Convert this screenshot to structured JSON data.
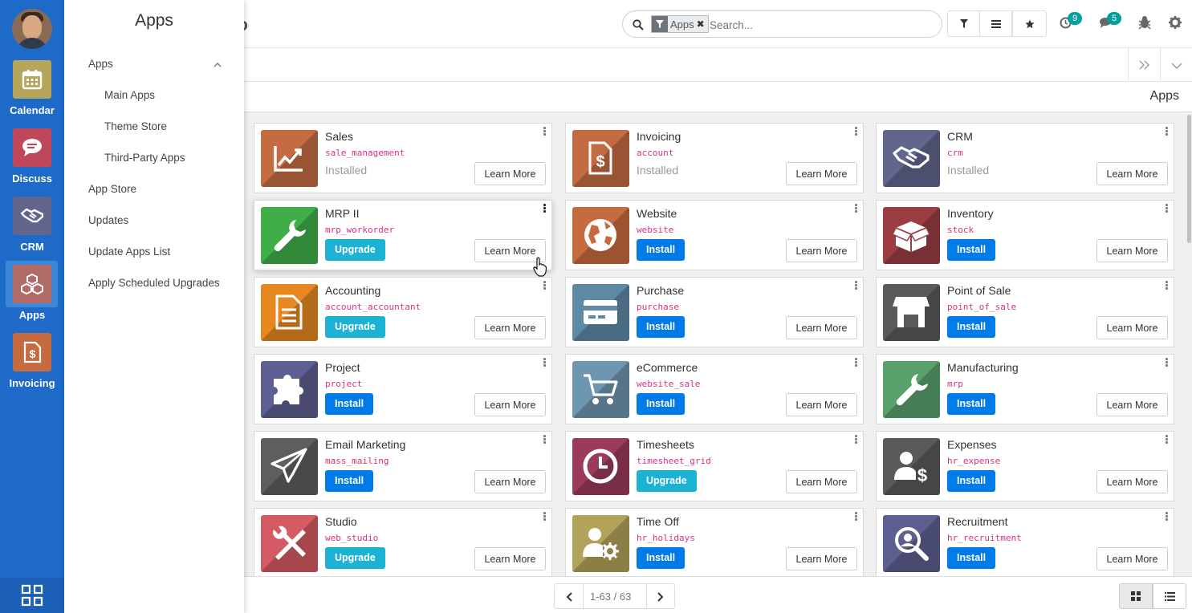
{
  "rail": {
    "items": [
      {
        "label": "Calendar",
        "icon": "calendar-icon",
        "color": "#b6a55a"
      },
      {
        "label": "Discuss",
        "icon": "chat-icon",
        "color": "#c0465a"
      },
      {
        "label": "CRM",
        "icon": "handshake-icon",
        "color": "#62668d"
      },
      {
        "label": "Apps",
        "icon": "cubes-icon",
        "color": "#b26b67"
      },
      {
        "label": "Invoicing",
        "icon": "invoice-icon",
        "color": "#c66a3f"
      }
    ]
  },
  "menu": {
    "title": "Apps",
    "items": [
      {
        "label": "Apps"
      },
      {
        "label": "Main Apps"
      },
      {
        "label": "Theme Store"
      },
      {
        "label": "Third-Party Apps"
      },
      {
        "label": "App Store"
      },
      {
        "label": "Updates"
      },
      {
        "label": "Update Apps List"
      },
      {
        "label": "Apply Scheduled Upgrades"
      }
    ]
  },
  "topbar": {
    "logo_fragment": "go",
    "search": {
      "facet": "Apps",
      "placeholder": "Search..."
    },
    "activity_count": "9",
    "message_count": "5"
  },
  "breadcrumb": "Apps",
  "learn_label": "Learn More",
  "installed_label": "Installed",
  "apps": [
    {
      "name": "Sales",
      "tech": "sale_management",
      "status": "installed",
      "action": "",
      "color": "#c46b41",
      "icon": "sales-chart-icon"
    },
    {
      "name": "Invoicing",
      "tech": "account",
      "status": "installed",
      "action": "",
      "color": "#c46b41",
      "icon": "invoice-icon"
    },
    {
      "name": "CRM",
      "tech": "crm",
      "status": "installed",
      "action": "",
      "color": "#62668d",
      "icon": "handshake-icon"
    },
    {
      "name": "MRP II",
      "tech": "mrp_workorder",
      "status": "upgrade",
      "action": "Upgrade",
      "color": "#3fae49",
      "icon": "wrench-icon"
    },
    {
      "name": "Website",
      "tech": "website",
      "status": "install",
      "action": "Install",
      "color": "#c66a3f",
      "icon": "globe-icon"
    },
    {
      "name": "Inventory",
      "tech": "stock",
      "status": "install",
      "action": "Install",
      "color": "#9a3e43",
      "icon": "box-icon"
    },
    {
      "name": "Accounting",
      "tech": "account_accountant",
      "status": "upgrade",
      "action": "Upgrade",
      "color": "#e6871f",
      "icon": "document-icon"
    },
    {
      "name": "Purchase",
      "tech": "purchase",
      "status": "install",
      "action": "Install",
      "color": "#5f8aa6",
      "icon": "credit-card-icon"
    },
    {
      "name": "Point of Sale",
      "tech": "point_of_sale",
      "status": "install",
      "action": "Install",
      "color": "#5a5a5a",
      "icon": "shop-icon"
    },
    {
      "name": "Project",
      "tech": "project",
      "status": "install",
      "action": "Install",
      "color": "#5e5f91",
      "icon": "puzzle-icon"
    },
    {
      "name": "eCommerce",
      "tech": "website_sale",
      "status": "install",
      "action": "Install",
      "color": "#6e96b0",
      "icon": "cart-icon"
    },
    {
      "name": "Manufacturing",
      "tech": "mrp",
      "status": "install",
      "action": "Install",
      "color": "#58a06c",
      "icon": "wrench-icon"
    },
    {
      "name": "Email Marketing",
      "tech": "mass_mailing",
      "status": "install",
      "action": "Install",
      "color": "#5e5e5e",
      "icon": "paper-plane-icon"
    },
    {
      "name": "Timesheets",
      "tech": "timesheet_grid",
      "status": "upgrade",
      "action": "Upgrade",
      "color": "#9b3b59",
      "icon": "clock-icon"
    },
    {
      "name": "Expenses",
      "tech": "hr_expense",
      "status": "install",
      "action": "Install",
      "color": "#5a5a5a",
      "icon": "user-dollar-icon"
    },
    {
      "name": "Studio",
      "tech": "web_studio",
      "status": "upgrade",
      "action": "Upgrade",
      "color": "#d45a63",
      "icon": "tools-icon"
    },
    {
      "name": "Time Off",
      "tech": "hr_holidays",
      "status": "install",
      "action": "Install",
      "color": "#b3a35a",
      "icon": "user-gear-icon"
    },
    {
      "name": "Recruitment",
      "tech": "hr_recruitment",
      "status": "install",
      "action": "Install",
      "color": "#5e5f91",
      "icon": "magnifier-icon"
    }
  ],
  "pager": {
    "value": "1-63 / 63"
  }
}
